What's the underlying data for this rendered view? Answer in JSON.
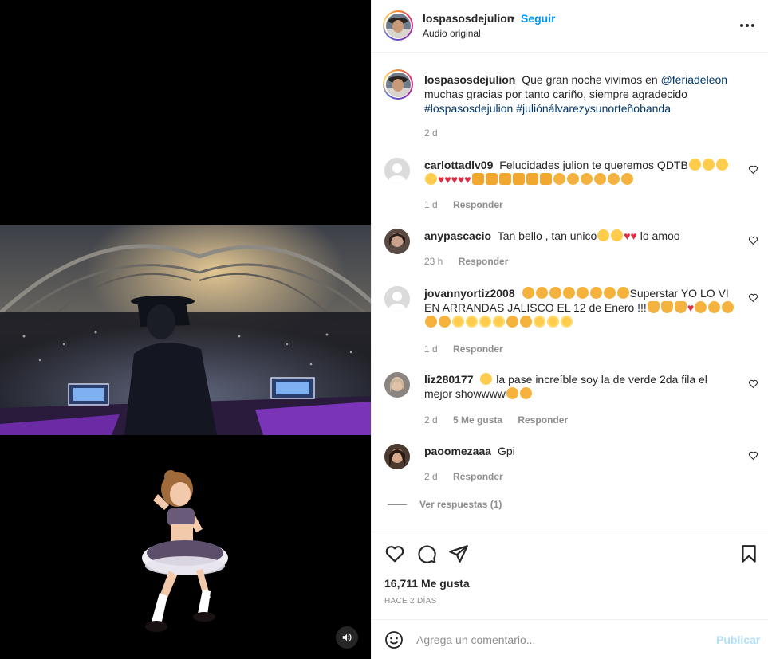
{
  "header": {
    "username": "lospasosdejulion",
    "separator": "•",
    "follow_label": "Seguir",
    "audio_label": "Audio original",
    "more_icon": "more-horizontal-icon"
  },
  "caption": {
    "username": "lospasosdejulion",
    "text_1": "Que gran noche vivimos en",
    "mention": "@feriadeleon",
    "text_2": "muchas gracias por tanto cariño, siempre agradecido",
    "hashtag_1": "#lospasosdejulion",
    "hashtag_2": "#juliónálvarezysunorteñobanda",
    "time": "2 d"
  },
  "comments": [
    {
      "username": "carlottadlv09",
      "text": "Felucidades julion te queremos QDTB",
      "time": "1 d",
      "reply_label": "Responder"
    },
    {
      "username": "anypascacio",
      "text_1": "Tan bello , tan unico",
      "text_2": "lo amoo",
      "time": "23 h",
      "reply_label": "Responder"
    },
    {
      "username": "jovannyortiz2008",
      "text_1": "Superstar YO LO VI EN ARRANDAS JALISCO EL 12 de Enero !!!",
      "time": "1 d",
      "reply_label": "Responder"
    },
    {
      "username": "liz280177",
      "text_1": "la pase increíble soy la de verde 2da fila el mejor showwww",
      "time": "2 d",
      "likes": "5 Me gusta",
      "reply_label": "Responder"
    },
    {
      "username": "paoomezaaa",
      "text": "Gpi",
      "time": "2 d",
      "reply_label": "Responder",
      "view_replies": "Ver respuestas (1)"
    }
  ],
  "actions": {
    "likes": "16,711 Me gusta",
    "posted_ago": "HACE 2 DÍAS"
  },
  "composer": {
    "placeholder": "Agrega un comentario...",
    "post_label": "Publicar"
  },
  "colors": {
    "accent": "#0095f6",
    "link": "#00376b",
    "muted": "#8e8e8e",
    "post_disabled": "#b2dffc"
  }
}
